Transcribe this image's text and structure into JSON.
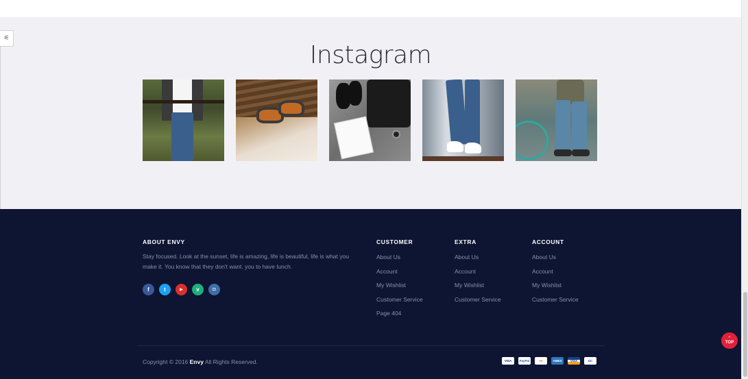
{
  "side_toggle": {
    "icon": "sliders-icon",
    "glyph": "⚟"
  },
  "instagram": {
    "title": "Instagram",
    "tiles": [
      {
        "icon": "photo-jeans-fence"
      },
      {
        "icon": "photo-shoes-wood"
      },
      {
        "icon": "photo-bag-notebook"
      },
      {
        "icon": "photo-jeans-sneakers"
      },
      {
        "icon": "photo-bike-jeans"
      }
    ]
  },
  "footer": {
    "about": {
      "heading": "ABOUT ENVY",
      "text": "Stay focused. Look at the sunset, life is amazing, life is beautiful, life is what you make it. You know that they don't want. you to have lunch."
    },
    "socials": [
      {
        "icon": "facebook-icon",
        "glyph": "f",
        "color": "#3b5998"
      },
      {
        "icon": "twitter-icon",
        "glyph": "t",
        "color": "#1da1f2"
      },
      {
        "icon": "youtube-icon",
        "glyph": "▶",
        "color": "#d9302c"
      },
      {
        "icon": "vine-icon",
        "glyph": "v",
        "color": "#1fae7e"
      },
      {
        "icon": "instagram-icon",
        "glyph": "◘",
        "color": "#3f6ea8"
      }
    ],
    "columns": [
      {
        "heading": "CUSTOMER",
        "links": [
          "About Us",
          "Account",
          "My Wishlist",
          "Customer Service",
          "Page 404"
        ]
      },
      {
        "heading": "EXTRA",
        "links": [
          "About Us",
          "Account",
          "My Wishlist",
          "Customer Service"
        ]
      },
      {
        "heading": "ACCOUNT",
        "links": [
          "About Us",
          "Account",
          "My Wishlist",
          "Customer Service"
        ]
      }
    ],
    "copyright": {
      "prefix": "Copyright © 2016 ",
      "brand": "Envy",
      "suffix": " All Rights Reserved."
    },
    "payments": [
      {
        "icon": "visa-icon",
        "label": "VISA"
      },
      {
        "icon": "paypal-icon",
        "label": "PayPal"
      },
      {
        "icon": "mastercard-icon",
        "label": "●●"
      },
      {
        "icon": "amex-icon",
        "label": "AMEX"
      },
      {
        "icon": "visa-card-icon",
        "label": "VISA"
      },
      {
        "icon": "diners-icon",
        "label": "DC"
      }
    ]
  },
  "top_button": {
    "label": "TOP",
    "arrow": "⌃"
  },
  "colors": {
    "footer_bg": "#0d1532",
    "section_bg": "#f1f1f5",
    "accent": "#e0213a",
    "link": "#8990a8"
  }
}
